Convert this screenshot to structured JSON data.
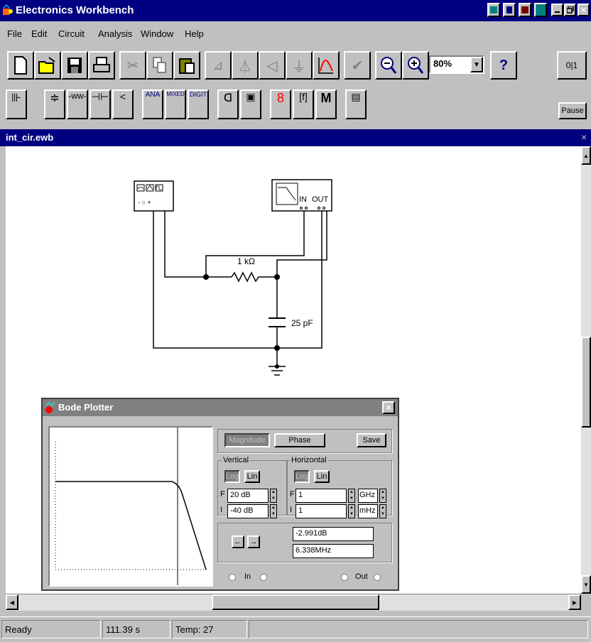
{
  "app": {
    "title": "Electronics Workbench"
  },
  "menu": {
    "file": "File",
    "edit": "Edit",
    "circuit": "Circuit",
    "analysis": "Analysis",
    "window": "Window",
    "help": "Help"
  },
  "toolbar": {
    "zoom_value": "80%",
    "help_label": "?",
    "pause_label": "Pause",
    "power_label": "0|1"
  },
  "parts_bin": {
    "ana": "ANA",
    "mixed": "MIXED",
    "digit": "DIGIT",
    "misc": "M"
  },
  "document": {
    "title": "int_cir.ewb"
  },
  "circuit": {
    "resistor_label": "1 kΩ",
    "capacitor_label": "25 pF",
    "bode_in_label": "IN",
    "bode_out_label": "OUT"
  },
  "bode": {
    "title": "Bode Plotter",
    "magnitude_label": "Magnitude",
    "phase_label": "Phase",
    "save_label": "Save",
    "vertical_label": "Vertical",
    "horizontal_label": "Horizontal",
    "log_label": "Log",
    "lin_label": "Lin",
    "v_final_prefix": "F",
    "v_initial_prefix": "I",
    "v_final_value": "20 dB",
    "v_initial_value": "-40 dB",
    "h_final_prefix": "F",
    "h_initial_prefix": "I",
    "h_final_value": "1",
    "h_initial_value": "1",
    "h_final_unit": "GHz",
    "h_initial_unit": "mHz",
    "left_arrow": "←",
    "right_arrow": "→",
    "readout_db": "-2.991dB",
    "readout_freq": "6.338MHz",
    "in_label": "In",
    "out_label": "Out"
  },
  "status": {
    "state": "Ready",
    "time": "111.39 s",
    "temp": "Temp: 27"
  },
  "colors": {
    "title_active": "#000080",
    "title_inactive": "#808080",
    "face": "#c0c0c0"
  }
}
